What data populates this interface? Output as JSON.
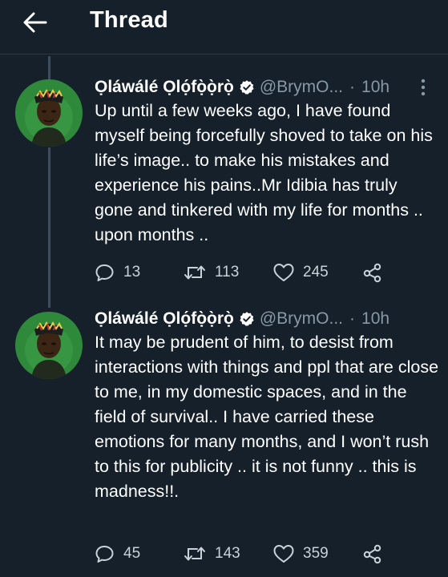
{
  "header": {
    "title": "Thread",
    "back_icon": "arrow-left-icon"
  },
  "colors": {
    "background": "#15202b",
    "text": "#ffffff",
    "muted": "#8899a6",
    "verified": "#ffffff"
  },
  "tweets": [
    {
      "author_name": "Ọláwálé Ọlọ́fọ̀ọ̀rọ̀",
      "verified": true,
      "handle": "@BrymO...",
      "separator": "·",
      "time": "10h",
      "text": "Up until a few weeks ago, I have found myself being forcefully shoved to take on his life’s image.. to make his mistakes and experience his pains..Mr Idibia has truly gone and tinkered with my life for months .. upon months ..",
      "replies": "13",
      "retweets": "113",
      "likes": "245"
    },
    {
      "author_name": "Ọláwálé Ọlọ́fọ̀ọ̀rọ̀",
      "verified": true,
      "handle": "@BrymO...",
      "separator": "·",
      "time": "10h",
      "text": "It may be prudent of him, to desist from interactions with things and ppl that are close to me, in my domestic spaces, and in the field of survival.. I have carried these emotions for many months, and I won’t rush to this for publicity .. it is not funny .. this is madness!!.",
      "replies": "45",
      "retweets": "143",
      "likes": "359"
    }
  ]
}
